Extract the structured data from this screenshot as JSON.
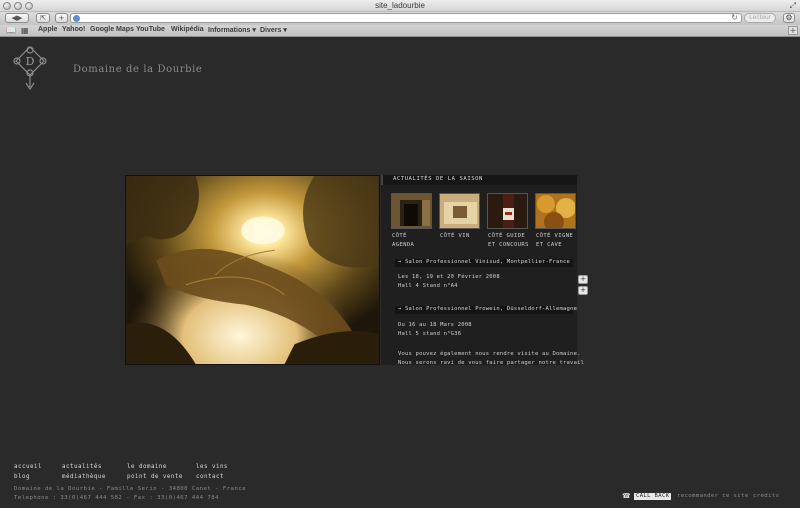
{
  "window": {
    "title": "site_ladourbie"
  },
  "toolbar": {
    "reader_label": "Lecteur"
  },
  "bookmarks": [
    "Apple",
    "Yahoo!",
    "Google Maps",
    "YouTube",
    "Wikipédia",
    "Informations ▾",
    "Divers ▾"
  ],
  "site": {
    "name": "Domaine de la Dourbie",
    "logo_letter": "D"
  },
  "news": {
    "title": "Actualités de la saison",
    "categories": [
      {
        "line1": "Côté",
        "line2": "agenda"
      },
      {
        "line1": "Côté vin",
        "line2": ""
      },
      {
        "line1": "Côté guide",
        "line2": "et concours"
      },
      {
        "line1": "Côté vigne",
        "line2": "et cave"
      }
    ],
    "events": [
      {
        "title": "→ Salon Professionnel Vinisud, Montpellier-France",
        "line1": "Les 18, 19 et 20 Février 2008",
        "line2": "Hall 4 Stand n°A4"
      },
      {
        "title": "→ Salon Professionnel Prowein, Düsseldorf-Allemagne",
        "line1": "Du 16 au 18 Mars 2008",
        "line2": "Hall 5 stand n°G36"
      }
    ],
    "closing_line1": "Vous pouvez également nous rendre visite au Domaine.",
    "closing_line2": "Nous serons ravi de vous faire partager notre travail"
  },
  "footer": {
    "nav": [
      "accueil",
      "actualités",
      "le domaine",
      "les vins",
      "blog",
      "médiathèque",
      "point de vente",
      "contact"
    ],
    "address": "Domaine de la Dourbie - Famille Serin - 34800 Canet - France",
    "contact": "Telephone : 33(0)467 444 582 - Fax : 33(0)467 444 784",
    "callback": "call back",
    "recommend": "recommander ce site",
    "credits": "crédits"
  },
  "colors": {
    "background": "#2a2a2a",
    "panel": "#1f1f1f",
    "text": "#d8d8d8"
  }
}
